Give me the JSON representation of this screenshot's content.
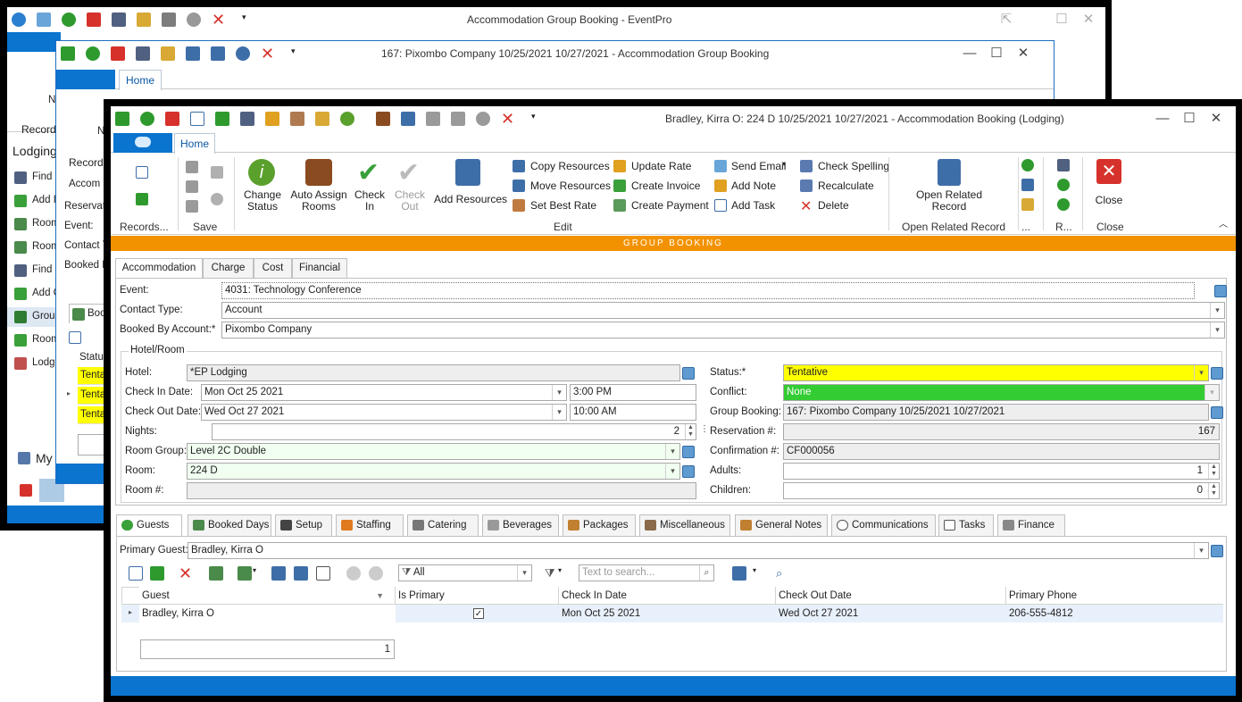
{
  "win1": {
    "title": "Accommodation Group Booking - EventPro",
    "side_labels": [
      "N",
      "Records",
      "Lodging"
    ],
    "side_items": [
      "Find I",
      "Add I",
      "Room",
      "Room",
      "Find C",
      "Add C",
      "Group",
      "Room",
      "Lodgi"
    ],
    "my": "My"
  },
  "win2": {
    "title": "167: Pixombo Company 10/25/2021 10/27/2021 - Accommodation Group Booking",
    "home_tab": "Home",
    "n_label": "N",
    "records": "Records",
    "labels": [
      "Accom",
      "Reservati",
      "Event:",
      "Contact T",
      "Booked B"
    ],
    "book_tab": "Boo",
    "status_header": "Statu",
    "rows": [
      "Tenta",
      "Tenta",
      "Tenta"
    ]
  },
  "win3": {
    "title": "Bradley, Kirra O: 224 D 10/25/2021 10/27/2021  - Accommodation Booking (Lodging)",
    "home_tab": "Home",
    "ribbon": {
      "records_group": "Records...",
      "save_group": "Save",
      "change_status": "Change Status",
      "auto_assign": "Auto Assign Rooms",
      "check_in": "Check In",
      "check_out": "Check Out",
      "add_resources": "Add Resources",
      "copy_resources": "Copy Resources",
      "move_resources": "Move Resources",
      "set_best_rate": "Set Best Rate",
      "update_rate": "Update Rate",
      "create_invoice": "Create Invoice",
      "create_payment": "Create Payment",
      "send_email": "Send Email",
      "add_note": "Add Note",
      "add_task": "Add Task",
      "check_spelling": "Check Spelling",
      "recalculate": "Recalculate",
      "delete": "Delete",
      "edit_group": "Edit",
      "open_related": "Open Related Record",
      "open_related_group": "Open Related Record",
      "dots_group": "...",
      "r_group": "R...",
      "close": "Close",
      "close_group": "Close"
    },
    "banner": "GROUP BOOKING",
    "top_tabs": [
      "Accommodation",
      "Charge",
      "Cost",
      "Financial"
    ],
    "form": {
      "event_label": "Event:",
      "event_value": "4031: Technology Conference",
      "contact_type_label": "Contact Type:",
      "contact_type_value": "Account",
      "booked_by_label": "Booked By Account:*",
      "booked_by_value": "Pixombo Company",
      "hotel_room_legend": "Hotel/Room",
      "hotel_label": "Hotel:",
      "hotel_value": "*EP Lodging",
      "checkin_label": "Check In Date:",
      "checkin_date": "Mon Oct 25 2021",
      "checkin_time": "3:00 PM",
      "checkout_label": "Check Out Date:",
      "checkout_date": "Wed Oct 27 2021",
      "checkout_time": "10:00 AM",
      "nights_label": "Nights:",
      "nights_value": "2",
      "room_group_label": "Room Group:",
      "room_group_value": "Level 2C Double",
      "room_label": "Room:",
      "room_value": "224 D",
      "room_num_label": "Room #:",
      "room_num_value": "",
      "status_label": "Status:*",
      "status_value": "Tentative",
      "conflict_label": "Conflict:",
      "conflict_value": "None",
      "group_booking_label": "Group Booking:",
      "group_booking_value": "167: Pixombo Company 10/25/2021 10/27/2021",
      "reservation_label": "Reservation #:",
      "reservation_value": "167",
      "confirmation_label": "Confirmation #:",
      "confirmation_value": "CF000056",
      "adults_label": "Adults:",
      "adults_value": "1",
      "children_label": "Children:",
      "children_value": "0"
    },
    "sub_tabs": [
      "Guests",
      "Booked Days",
      "Setup",
      "Staffing",
      "Catering",
      "Beverages",
      "Packages",
      "Miscellaneous",
      "General Notes",
      "Communications",
      "Tasks",
      "Finance"
    ],
    "primary_guest_label": "Primary Guest:",
    "primary_guest_value": "Bradley, Kirra O",
    "filter_value": "All",
    "search_placeholder": "Text to search...",
    "grid": {
      "headers": [
        "Guest",
        "Is Primary",
        "Check In Date",
        "Check Out Date",
        "Primary Phone"
      ],
      "rows": [
        {
          "guest": "Bradley, Kirra O",
          "is_primary": "✓",
          "check_in": "Mon Oct 25 2021",
          "check_out": "Wed Oct 27 2021",
          "phone": "206-555-4812"
        }
      ],
      "count": "1"
    }
  },
  "colors": {
    "accent_blue": "#0a74cf",
    "orange_banner": "#f39200",
    "status_yellow": "#ffff00",
    "conflict_green": "#33cc33",
    "frame_black": "#000000"
  }
}
